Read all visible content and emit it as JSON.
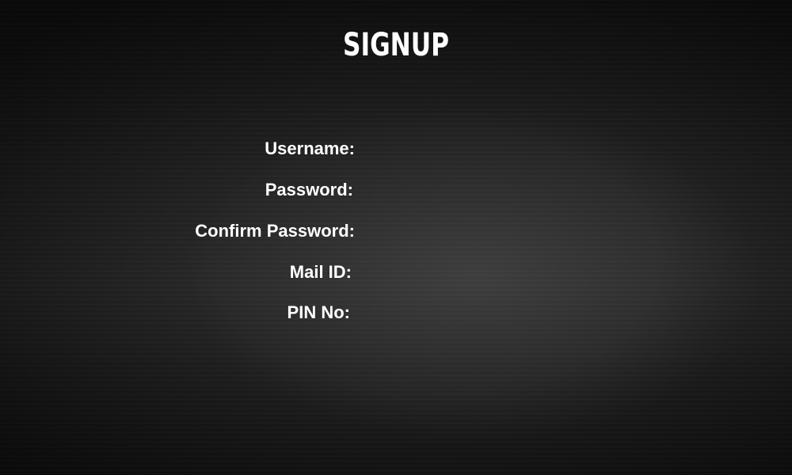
{
  "page": {
    "title": "SIGNUP"
  },
  "form": {
    "fields": [
      {
        "label": "Username:",
        "value": ""
      },
      {
        "label": "Password:",
        "value": ""
      },
      {
        "label": "Confirm Password:",
        "value": ""
      },
      {
        "label": "Mail ID:",
        "value": ""
      },
      {
        "label": "PIN No:",
        "value": ""
      }
    ]
  },
  "colors": {
    "background": "#1c1c1c",
    "text": "#ffffff"
  }
}
